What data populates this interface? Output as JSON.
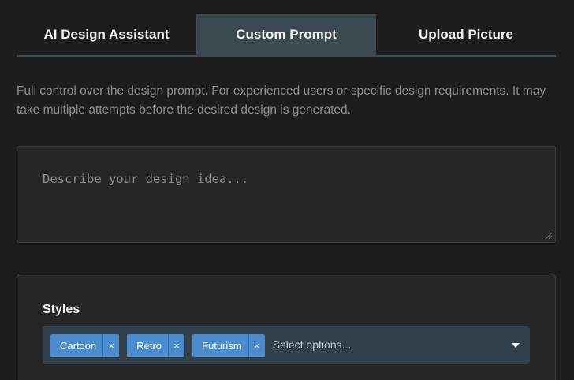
{
  "tabs": [
    {
      "label": "AI Design Assistant"
    },
    {
      "label": "Custom Prompt"
    },
    {
      "label": "Upload Picture"
    }
  ],
  "active_tab": "Custom Prompt",
  "description": "Full control over the design prompt. For experienced users or specific design requirements. It may take multiple attempts before the desired design is generated.",
  "prompt": {
    "value": "",
    "placeholder": "Describe your design idea..."
  },
  "styles": {
    "label": "Styles",
    "selected": [
      {
        "label": "Cartoon"
      },
      {
        "label": "Retro"
      },
      {
        "label": "Futurism"
      }
    ],
    "remove_glyph": "×",
    "placeholder": "Select options..."
  },
  "icons": {
    "remove": "close-icon",
    "dropdown": "chevron-down-icon",
    "resize": "resize-grip-icon"
  },
  "colors": {
    "background": "#1d1d1d",
    "active_tab": "#3b4a51",
    "chip": "#4a8ccd",
    "select_bg": "#31404a"
  }
}
